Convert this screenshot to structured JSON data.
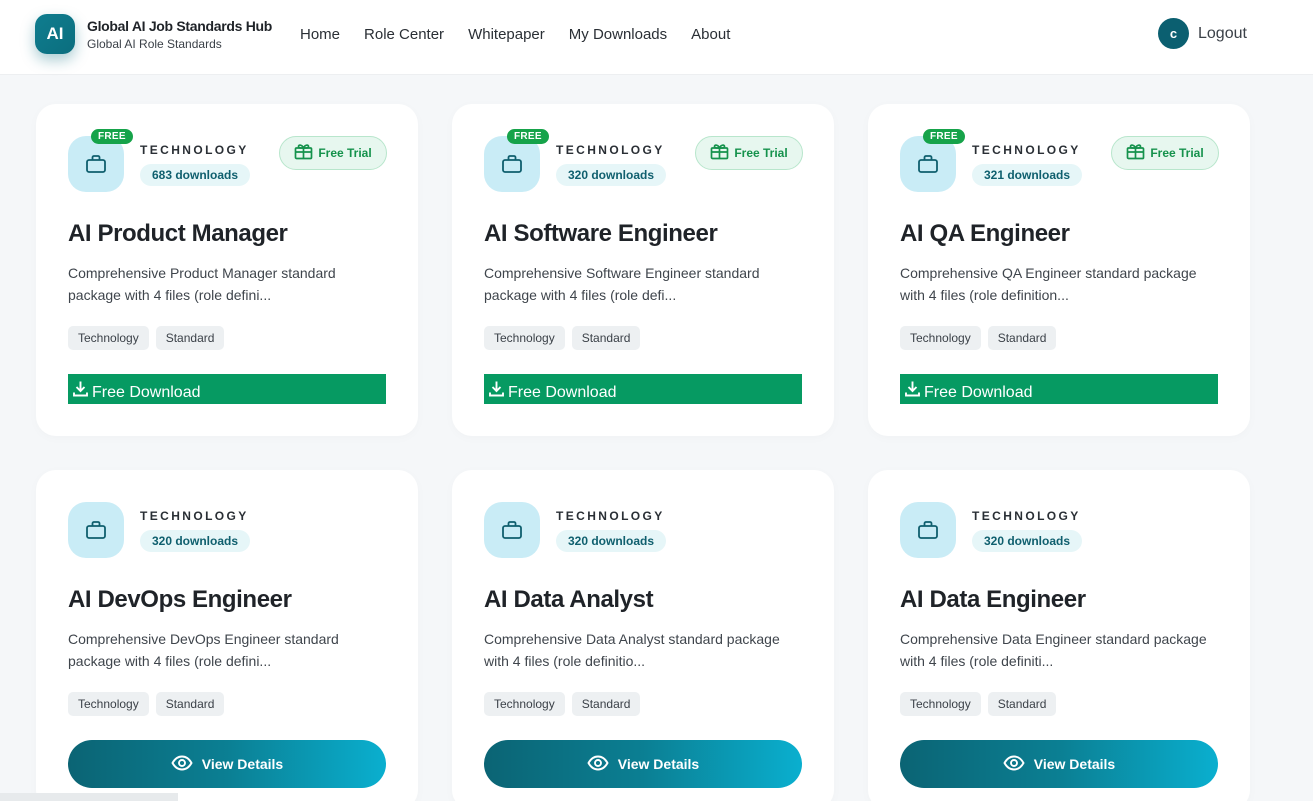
{
  "brand": {
    "logo_text": "AI",
    "title": "Global AI Job Standards Hub",
    "subtitle": "Global AI Role Standards"
  },
  "nav": [
    "Home",
    "Role Center",
    "Whitepaper",
    "My Downloads",
    "About"
  ],
  "user": {
    "avatar_letter": "c",
    "logout_label": "Logout"
  },
  "colors": {
    "accent": "#0b6e7e",
    "free_green": "#069a62",
    "badge_green": "#16a34a"
  },
  "cards": [
    {
      "free_badge": "FREE",
      "category": "TECHNOLOGY",
      "downloads": "683 downloads",
      "trial_label": "Free Trial",
      "title": "AI Product Manager",
      "description": "Comprehensive Product Manager standard package with 4 files (role defini...",
      "tags": [
        "Technology",
        "Standard"
      ],
      "action_label": "Free Download",
      "action_icon": "download-icon"
    },
    {
      "free_badge": "FREE",
      "category": "TECHNOLOGY",
      "downloads": "320 downloads",
      "trial_label": "Free Trial",
      "title": "AI Software Engineer",
      "description": "Comprehensive Software Engineer standard package with 4 files (role defi...",
      "tags": [
        "Technology",
        "Standard"
      ],
      "action_label": "Free Download",
      "action_icon": "download-icon"
    },
    {
      "free_badge": "FREE",
      "category": "TECHNOLOGY",
      "downloads": "321 downloads",
      "trial_label": "Free Trial",
      "title": "AI QA Engineer",
      "description": "Comprehensive QA Engineer standard package with 4 files (role definition...",
      "tags": [
        "Technology",
        "Standard"
      ],
      "action_label": "Free Download",
      "action_icon": "download-icon"
    },
    {
      "category": "TECHNOLOGY",
      "downloads": "320 downloads",
      "title": "AI DevOps Engineer",
      "description": "Comprehensive DevOps Engineer standard package with 4 files (role defini...",
      "tags": [
        "Technology",
        "Standard"
      ],
      "action_label": "View Details",
      "action_icon": "eye-icon"
    },
    {
      "category": "TECHNOLOGY",
      "downloads": "320 downloads",
      "title": "AI Data Analyst",
      "description": "Comprehensive Data Analyst standard package with 4 files (role definitio...",
      "tags": [
        "Technology",
        "Standard"
      ],
      "action_label": "View Details",
      "action_icon": "eye-icon"
    },
    {
      "category": "TECHNOLOGY",
      "downloads": "320 downloads",
      "title": "AI Data Engineer",
      "description": "Comprehensive Data Engineer standard package with 4 files (role definiti...",
      "tags": [
        "Technology",
        "Standard"
      ],
      "action_label": "View Details",
      "action_icon": "eye-icon"
    }
  ]
}
